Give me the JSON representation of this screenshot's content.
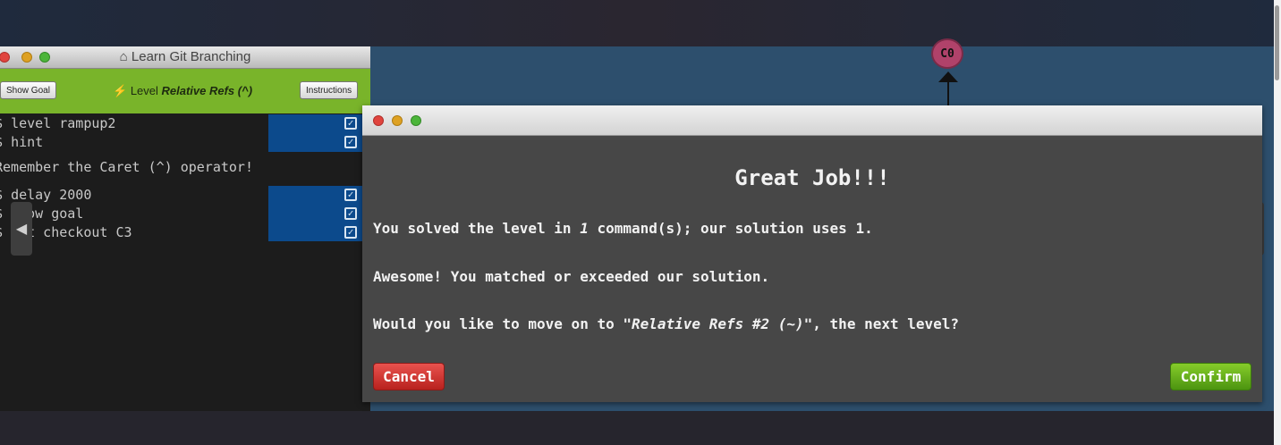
{
  "window": {
    "title": "Learn Git Branching",
    "home_icon": "home-icon"
  },
  "level_bar": {
    "show_goal_label": "Show Goal",
    "level_prefix": "Level",
    "level_name": "Relative Refs (^)",
    "instructions_label": "Instructions",
    "bolt_icon": "lightning-icon"
  },
  "commands": [
    {
      "prompt": "$",
      "text": "level rampup2"
    },
    {
      "prompt": "$",
      "text": "hint"
    }
  ],
  "hint_output": "Remember the Caret (^) operator!",
  "commands2": [
    {
      "prompt": "$",
      "text": "delay 2000"
    },
    {
      "prompt": "$",
      "text": "show goal"
    },
    {
      "prompt": "$",
      "text": "git checkout C3"
    }
  ],
  "visualization": {
    "commit_label": "C0"
  },
  "modal": {
    "heading": "Great Job!!!",
    "line1_prefix": "You solved the level in ",
    "line1_count": "1",
    "line1_suffix": " command(s); our solution uses 1.",
    "line2": "Awesome! You matched or exceeded our solution.",
    "line3_prefix": "Would you like to move on to ",
    "line3_level": "\"Relative Refs #2 (~)\"",
    "line3_suffix": ", the next level?",
    "cancel_label": "Cancel",
    "confirm_label": "Confirm"
  },
  "colors": {
    "level_bar": "#79b42a",
    "modal_bg": "#474747",
    "cancel": "#d23a35",
    "confirm": "#6cb31e",
    "vis_bg": "#2d4f6d"
  }
}
